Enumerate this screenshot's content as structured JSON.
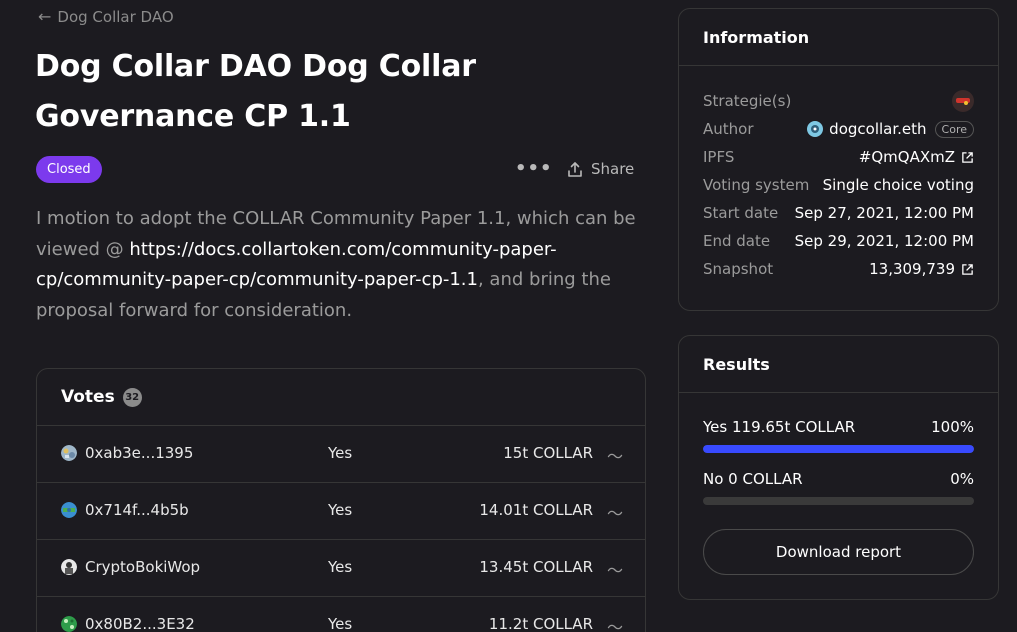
{
  "back": {
    "label": "Dog Collar DAO"
  },
  "proposal": {
    "title": "Dog Collar DAO Dog Collar Governance CP 1.1",
    "status": "Closed",
    "share_label": "Share",
    "body_prefix": "I motion to adopt the COLLAR Community Paper 1.1, which can be viewed @ ",
    "body_link": "https://docs.collartoken.com/community-paper-cp/community-paper-cp/community-paper-cp-1.1",
    "body_suffix": ", and bring the proposal forward for consideration."
  },
  "votes": {
    "title": "Votes",
    "count": "32",
    "rows": [
      {
        "voter": "0xab3e...1395",
        "choice": "Yes",
        "power": "15t COLLAR"
      },
      {
        "voter": "0x714f...4b5b",
        "choice": "Yes",
        "power": "14.01t COLLAR"
      },
      {
        "voter": "CryptoBokiWop",
        "choice": "Yes",
        "power": "13.45t COLLAR"
      },
      {
        "voter": "0x80B2...3E32",
        "choice": "Yes",
        "power": "11.2t COLLAR"
      }
    ]
  },
  "information": {
    "title": "Information",
    "strategies_label": "Strategie(s)",
    "author_label": "Author",
    "author": "dogcollar.eth",
    "author_tag": "Core",
    "ipfs_label": "IPFS",
    "ipfs": "#QmQAXmZ",
    "voting_system_label": "Voting system",
    "voting_system": "Single choice voting",
    "start_label": "Start date",
    "start": "Sep 27, 2021, 12:00 PM",
    "end_label": "End date",
    "end": "Sep 29, 2021, 12:00 PM",
    "snapshot_label": "Snapshot",
    "snapshot": "13,309,739"
  },
  "results": {
    "title": "Results",
    "options": [
      {
        "label": "Yes 119.65t COLLAR",
        "percent": "100%",
        "fraction": 1.0
      },
      {
        "label": "No 0 COLLAR",
        "percent": "0%",
        "fraction": 0.0
      }
    ],
    "download_label": "Download report"
  },
  "colors": {
    "background": "#1c1b20",
    "accent": "#384aff",
    "closed_badge": "#7c3aed",
    "border": "#363636",
    "muted_text": "#9b9b9b"
  }
}
